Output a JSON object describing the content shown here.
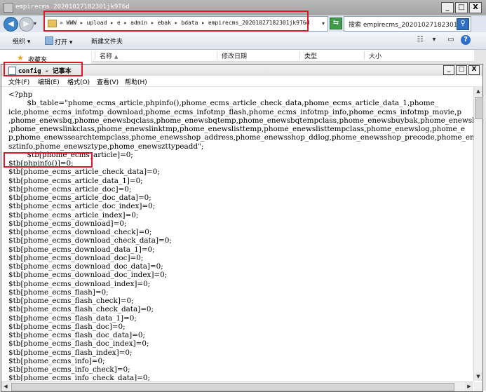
{
  "explorer": {
    "title": "empirecms 20201027182301jk9T6d",
    "window_buttons": [
      "_",
      "□",
      "X"
    ],
    "breadcrumb": "» WWW ▸ upload ▸ e ▸ admin ▸ ebak ▸ bdata ▸ empirecms_20201027182301jk9T6d",
    "search_text": "搜索 empirecms_20201027182301...",
    "toolbar": {
      "organize": "组织 ▾",
      "open": "打开 ▾",
      "new_folder": "新建文件夹"
    },
    "nav": {
      "favorites": "收藏夹"
    },
    "columns": [
      "名称",
      "修改日期",
      "类型",
      "大小"
    ]
  },
  "notepad": {
    "title": "config - 记事本",
    "window_buttons": [
      "_",
      "□",
      "X"
    ],
    "menu": [
      "文件(F)",
      "编辑(E)",
      "格式(O)",
      "查看(V)",
      "帮助(H)"
    ],
    "lines": [
      "<?php",
      "        $b_table=\"phome_ecms_article,phpinfo(),phome_ecms_article_check_data,phome_ecms_article_data_1,phome_",
      "icle,phome_ecms_infotmp_download,phome_ecms_infotmp_flash,phome_ecms_infotmp_info,phome_ecms_infotmp_movie,p",
      ",phome_enewsbq,phome_enewsbqclass,phome_enewsbqtemp,phome_enewsbqtempclass,phome_enewsbuybak,phome_enewsbuyg",
      ",phome_enewslinkclass,phome_enewslinktmp,phome_enewslisttemp,phome_enewslisttempclass,phome_enewslog,phome_e",
      "p,phome_enewssearchtempclass,phome_enewsshop_address,phome_enewsshop_ddlog,phome_enewsshop_precode,phome_ene",
      "sztinfo,phome_enewsztype,phome_enewszttypeadd\";",
      "        $tb[phome_ecms_article]=0;",
      "$tb[phpinfo()]=0;",
      "$tb[phome_ecms_article_check_data]=0;",
      "$tb[phome_ecms_article_data_1]=0;",
      "$tb[phome_ecms_article_doc]=0;",
      "$tb[phome_ecms_article_doc_data]=0;",
      "$tb[phome_ecms_article_doc_index]=0;",
      "$tb[phome_ecms_article_index]=0;",
      "$tb[phome_ecms_download]=0;",
      "$tb[phome_ecms_download_check]=0;",
      "$tb[phome_ecms_download_check_data]=0;",
      "$tb[phome_ecms_download_data_1]=0;",
      "$tb[phome_ecms_download_doc]=0;",
      "$tb[phome_ecms_download_doc_data]=0;",
      "$tb[phome_ecms_download_doc_index]=0;",
      "$tb[phome_ecms_download_index]=0;",
      "$tb[phome_ecms_flash]=0;",
      "$tb[phome_ecms_flash_check]=0;",
      "$tb[phome_ecms_flash_check_data]=0;",
      "$tb[phome_ecms_flash_data_1]=0;",
      "$tb[phome_ecms_flash_doc]=0;",
      "$tb[phome_ecms_flash_doc_data]=0;",
      "$tb[phome_ecms_flash_doc_index]=0;",
      "$tb[phome_ecms_flash_index]=0;",
      "$tb[phome_ecms_info]=0;",
      "$tb[phome_ecms_info_check]=0;",
      "$tb[phome_ecms_info_check_data]=0;"
    ]
  },
  "colors": {
    "highlight": "#e0192a"
  }
}
